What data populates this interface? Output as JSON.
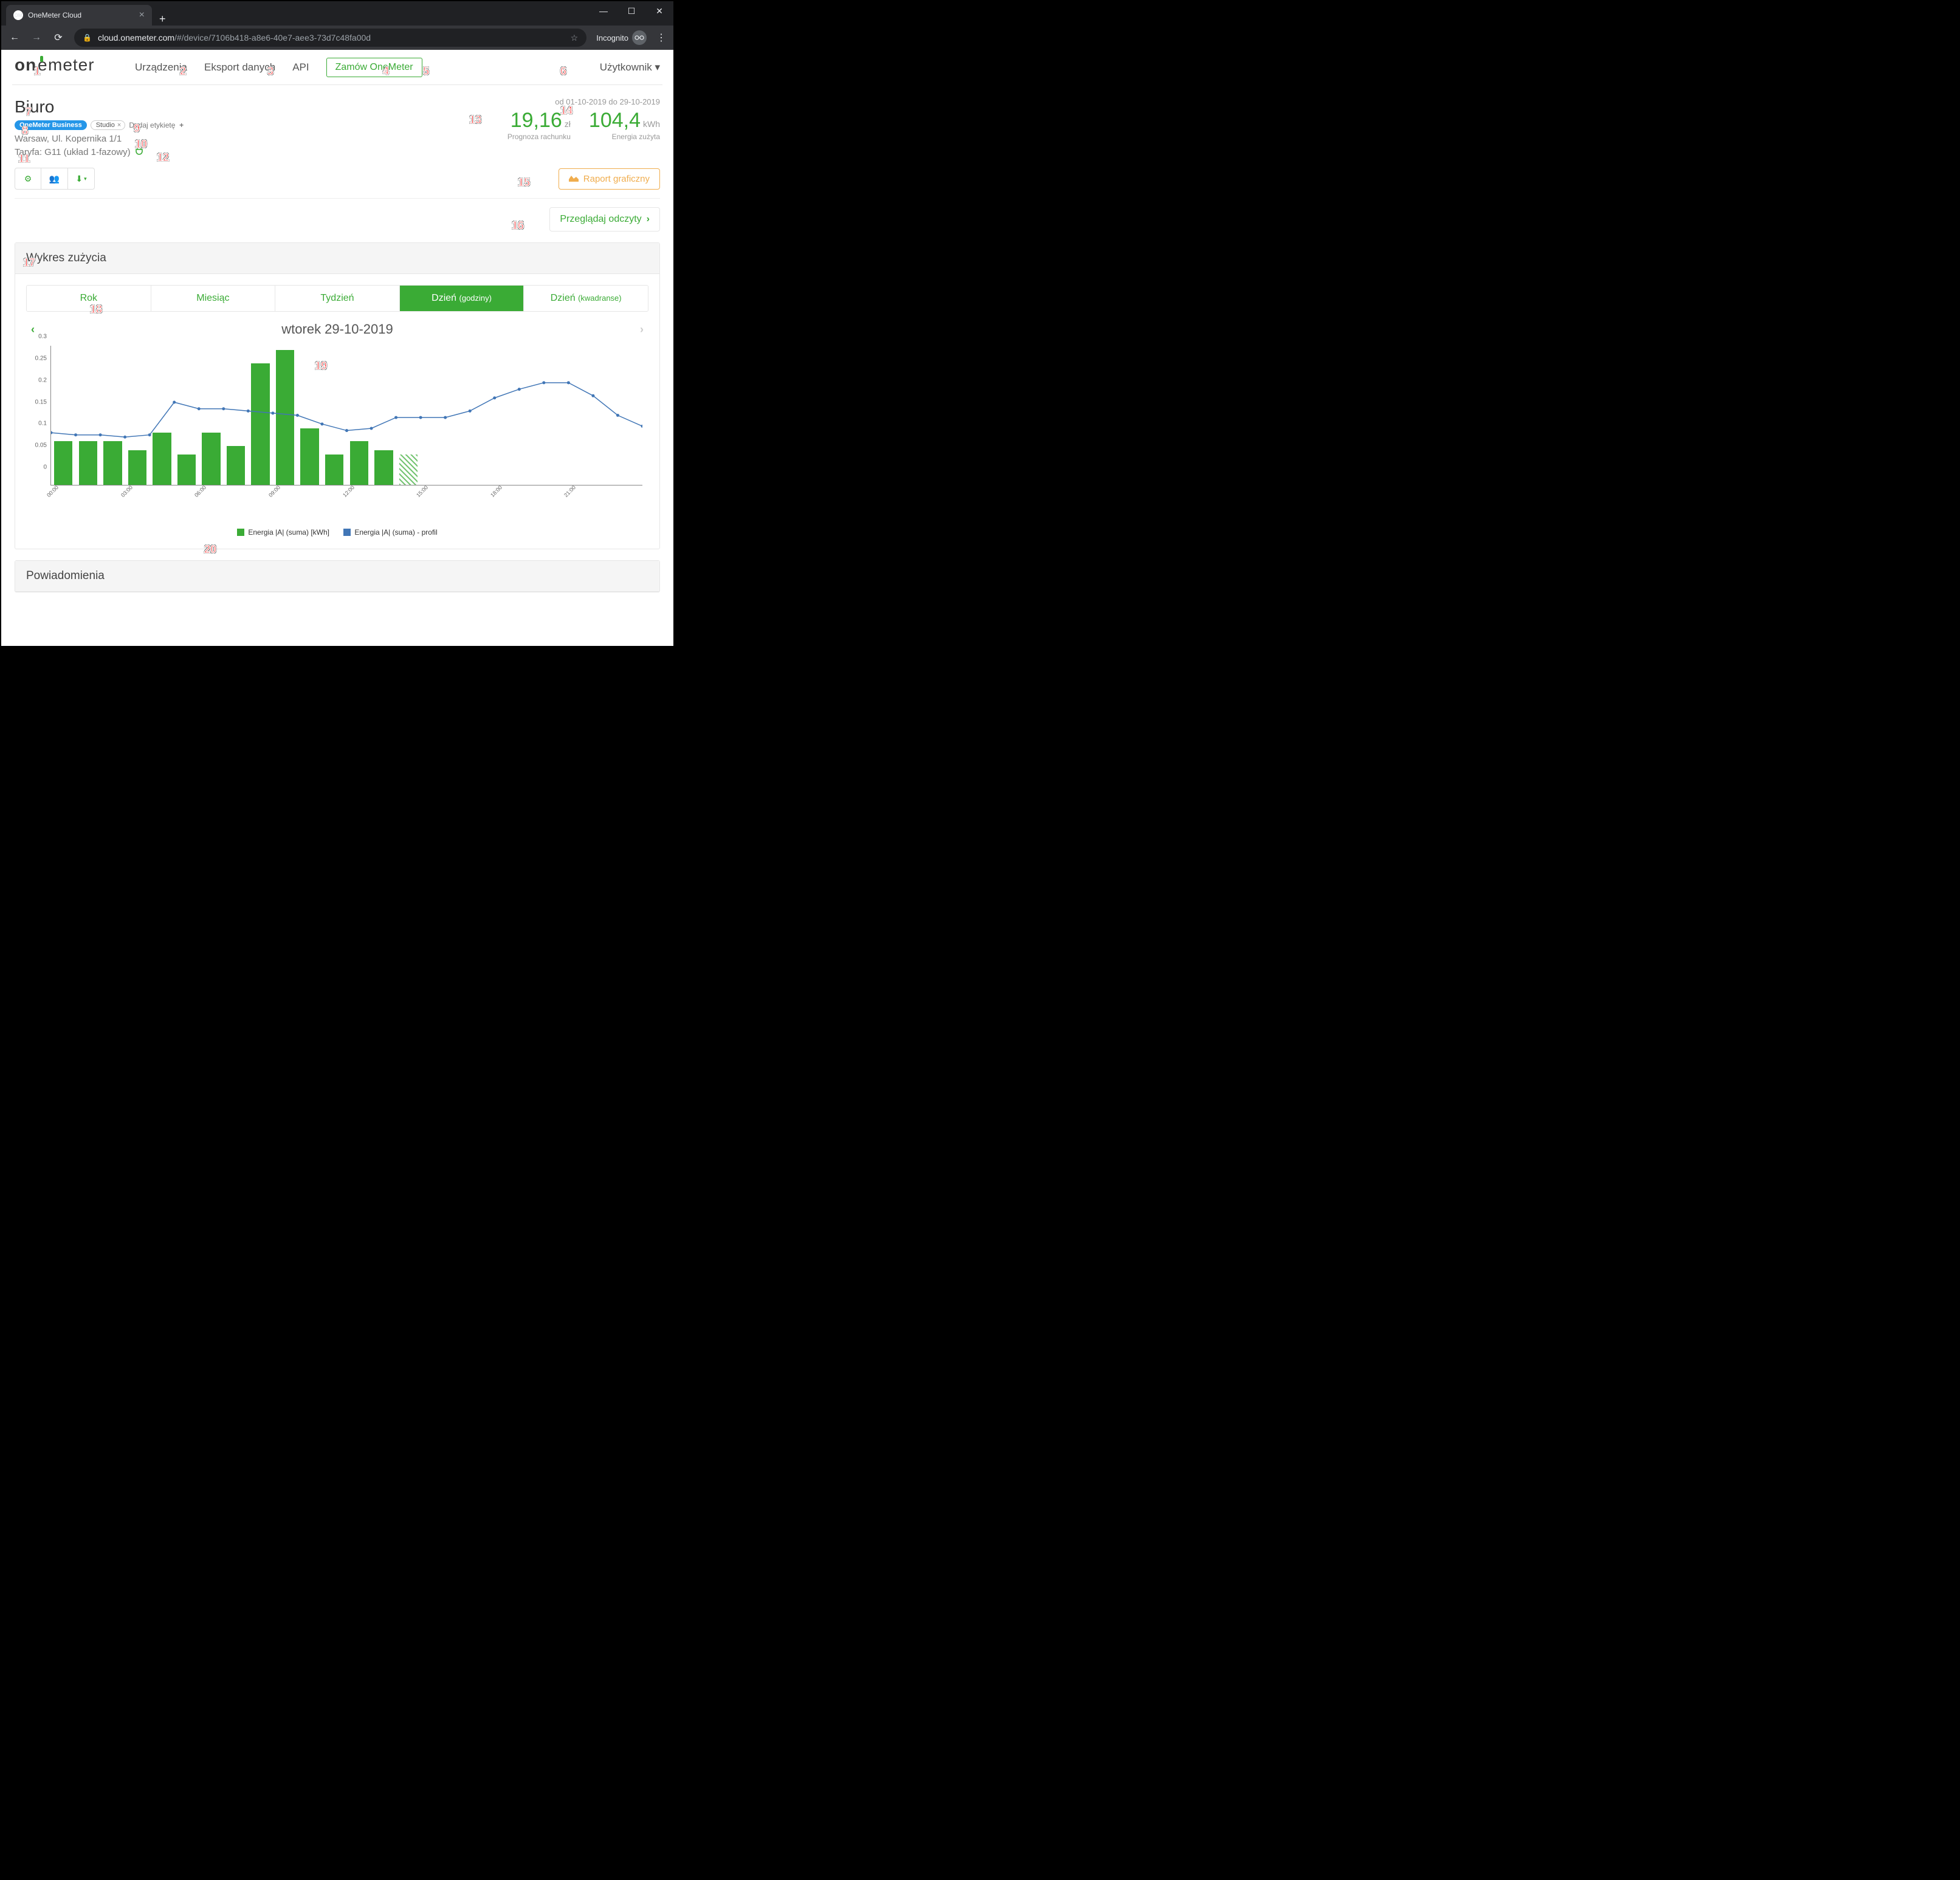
{
  "browser": {
    "tab_title": "OneMeter Cloud",
    "url_domain": "cloud.onemeter.com",
    "url_path": "/#/device/7106b418-a8e6-40e7-aee3-73d7c48fa00d",
    "incognito": "Incognito"
  },
  "nav": {
    "logo": "onemeter",
    "devices": "Urządzenia",
    "export": "Eksport danych",
    "api": "API",
    "order": "Zamów OneMeter",
    "user": "Użytkownik"
  },
  "device": {
    "name": "Biuro",
    "badge_business": "OneMeter Business",
    "badge_studio": "Studio",
    "add_label": "Dodaj etykietę",
    "address": "Warsaw, Ul. Kopernika 1/1",
    "tariff": "Taryfa: G11 (układ 1-fazowy)",
    "date_range": "od 01-10-2019 do 29-10-2019",
    "bill_value": "19,16",
    "bill_unit": "zł",
    "bill_label": "Prognoza rachunku",
    "energy_value": "104,4",
    "energy_unit": "kWh",
    "energy_label": "Energia zużyta",
    "report_btn": "Raport graficzny",
    "browse_btn": "Przeglądaj odczyty"
  },
  "chart_panel": {
    "title": "Wykres zużycia",
    "tabs": {
      "year": "Rok",
      "month": "Miesiąc",
      "week": "Tydzień",
      "day_h": "Dzień",
      "day_h_sub": "(godziny)",
      "day_q": "Dzień",
      "day_q_sub": "(kwadranse)"
    },
    "date_title": "wtorek 29-10-2019",
    "legend_bar": "Energia |A| (suma) [kWh]",
    "legend_line": "Energia |A| (suma) - profil"
  },
  "chart_data": {
    "type": "bar",
    "title": "wtorek 29-10-2019",
    "xlabel": "",
    "ylabel": "",
    "ylim": [
      0,
      0.32
    ],
    "y_ticks": [
      0,
      0.05,
      0.1,
      0.15,
      0.2,
      0.25,
      0.3
    ],
    "x_ticks": [
      "00:00",
      "03:00",
      "06:00",
      "09:00",
      "12:00",
      "15:00",
      "18:00",
      "21:00"
    ],
    "categories": [
      "00:00",
      "01:00",
      "02:00",
      "03:00",
      "04:00",
      "05:00",
      "06:00",
      "07:00",
      "08:00",
      "09:00",
      "10:00",
      "11:00",
      "12:00",
      "13:00",
      "14:00"
    ],
    "series": [
      {
        "name": "Energia |A| (suma) [kWh]",
        "type": "bar",
        "values": [
          0.1,
          0.1,
          0.1,
          0.08,
          0.12,
          0.07,
          0.12,
          0.09,
          0.28,
          0.31,
          0.13,
          0.07,
          0.1,
          0.08,
          0.07
        ],
        "hatched_index": 14
      },
      {
        "name": "Energia |A| (suma) - profil",
        "type": "line",
        "x_hours": [
          0,
          1,
          2,
          3,
          4,
          5,
          6,
          7,
          8,
          9,
          10,
          11,
          12,
          13,
          14,
          15,
          16,
          17,
          18,
          19,
          20,
          21,
          22,
          23
        ],
        "values": [
          0.12,
          0.115,
          0.115,
          0.11,
          0.115,
          0.19,
          0.175,
          0.175,
          0.17,
          0.165,
          0.16,
          0.14,
          0.125,
          0.13,
          0.155,
          0.155,
          0.155,
          0.17,
          0.2,
          0.22,
          0.235,
          0.235,
          0.205,
          0.16,
          0.135
        ]
      }
    ]
  },
  "notifications": {
    "title": "Powiadomienia"
  }
}
